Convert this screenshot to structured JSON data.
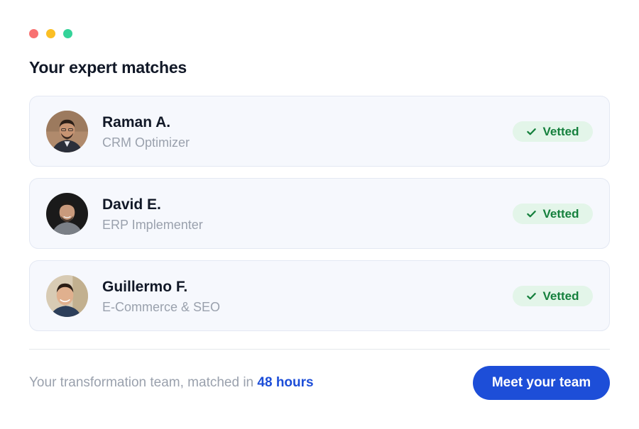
{
  "window_controls": {
    "colors": [
      "#f87171",
      "#fbbf24",
      "#34d399"
    ],
    "icons": [
      "close-dot",
      "minimize-dot",
      "maximize-dot"
    ]
  },
  "title": "Your expert matches",
  "experts": [
    {
      "name": "Raman A.",
      "role": "CRM Optimizer",
      "badge": "Vetted",
      "badge_icon": "check-icon"
    },
    {
      "name": "David E.",
      "role": "ERP Implementer",
      "badge": "Vetted",
      "badge_icon": "check-icon"
    },
    {
      "name": "Guillermo F.",
      "role": "E-Commerce & SEO",
      "badge": "Vetted",
      "badge_icon": "check-icon"
    }
  ],
  "footer": {
    "text_prefix": "Your transformation team, matched in ",
    "text_highlight": "48 hours",
    "cta_label": "Meet your team"
  },
  "colors": {
    "accent": "#1d4ed8",
    "badge_bg": "#e3f5e9",
    "badge_text": "#15803d",
    "muted_text": "#9aa1ad"
  }
}
